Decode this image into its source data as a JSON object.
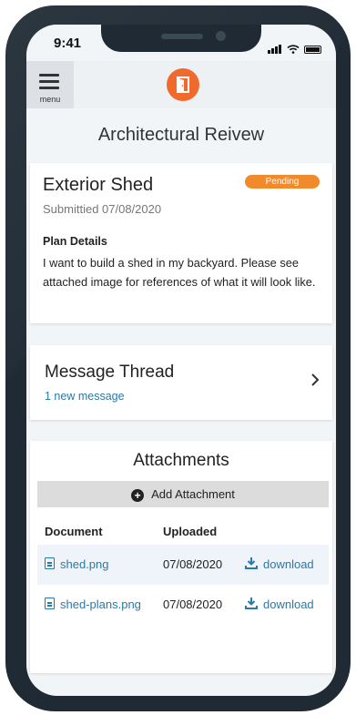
{
  "status_bar": {
    "time": "9:41"
  },
  "app_bar": {
    "menu_label": "menu"
  },
  "page": {
    "title": "Architectural Reivew"
  },
  "request": {
    "title": "Exterior Shed",
    "status": "Pending",
    "submitted": "Submittied 07/08/2020",
    "plan_label": "Plan Details",
    "plan_text": "I want to build a shed in my backyard.  Please see attached image for references of what it will look like."
  },
  "thread": {
    "title": "Message Thread",
    "subtitle": "1 new message"
  },
  "attachments": {
    "title": "Attachments",
    "add_label": "Add Attachment",
    "columns": {
      "document": "Document",
      "uploaded": "Uploaded"
    },
    "rows": [
      {
        "name": "shed.png",
        "date": "07/08/2020",
        "action": "download"
      },
      {
        "name": "shed-plans.png",
        "date": "07/08/2020",
        "action": "download"
      }
    ]
  },
  "colors": {
    "accent": "#ef6a2c",
    "badge": "#f08a2a",
    "link": "#2a7aa8",
    "frame": "#1f2a34"
  },
  "icons": [
    "menu-icon",
    "door-logo-icon",
    "chevron-right-icon",
    "plus-circle-icon",
    "file-icon",
    "download-icon",
    "signal-icon",
    "wifi-icon",
    "battery-icon"
  ]
}
